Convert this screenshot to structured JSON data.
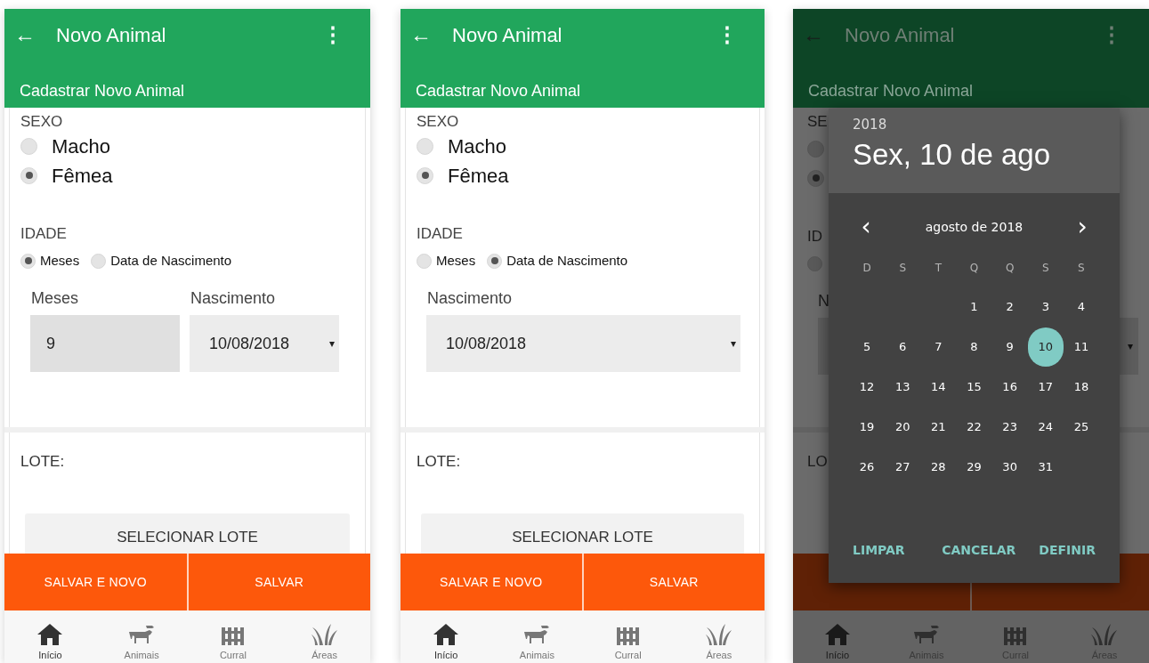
{
  "screens": [
    {
      "kind": "form",
      "header": {
        "back": "←",
        "title": "Novo Animal",
        "menu": "⋮",
        "subtitle": "Cadastrar Novo Animal"
      },
      "sexo": {
        "label": "SEXO",
        "options": [
          {
            "label": "Macho",
            "selected": false
          },
          {
            "label": "Fêmea",
            "selected": true
          }
        ]
      },
      "idade": {
        "label": "IDADE",
        "options": [
          {
            "label": "Meses",
            "selected": true
          },
          {
            "label": "Data de Nascimento",
            "selected": false
          }
        ]
      },
      "fields": [
        {
          "kind": "text",
          "label": "Meses",
          "value": "9"
        },
        {
          "kind": "select",
          "label": "Nascimento",
          "value": "10/08/2018",
          "arrow": "▾"
        }
      ],
      "lote": {
        "label": "LOTE:",
        "button": "SELECIONAR LOTE"
      },
      "actions": [
        "SALVAR E NOVO",
        "SALVAR"
      ],
      "nav": [
        {
          "label": "Início",
          "kind": "house",
          "selected": true
        },
        {
          "label": "Animais",
          "kind": "cattle",
          "selected": false
        },
        {
          "label": "Curral",
          "kind": "fence",
          "selected": false
        },
        {
          "label": "Áreas",
          "kind": "grass",
          "selected": false
        }
      ]
    },
    {
      "kind": "form",
      "header": {
        "back": "←",
        "title": "Novo Animal",
        "menu": "⋮",
        "subtitle": "Cadastrar Novo Animal"
      },
      "sexo": {
        "label": "SEXO",
        "options": [
          {
            "label": "Macho",
            "selected": false
          },
          {
            "label": "Fêmea",
            "selected": true
          }
        ]
      },
      "idade": {
        "label": "IDADE",
        "options": [
          {
            "label": "Meses",
            "selected": false
          },
          {
            "label": "Data de Nascimento",
            "selected": true
          }
        ]
      },
      "fields": [
        {
          "kind": "select",
          "label": "Nascimento",
          "value": "10/08/2018",
          "arrow": "▾"
        }
      ],
      "lote": {
        "label": "LOTE:",
        "button": "SELECIONAR LOTE"
      },
      "actions": [
        "SALVAR E NOVO",
        "SALVAR"
      ],
      "nav": [
        {
          "label": "Início",
          "kind": "house",
          "selected": true
        },
        {
          "label": "Animais",
          "kind": "cattle",
          "selected": false
        },
        {
          "label": "Curral",
          "kind": "fence",
          "selected": false
        },
        {
          "label": "Áreas",
          "kind": "grass",
          "selected": false
        }
      ]
    },
    {
      "kind": "picker",
      "header": {
        "back": "←",
        "title": "Novo Animal",
        "menu": "⋮",
        "subtitle": "Cadastrar Novo Animal"
      },
      "fragments": {
        "sexo": "SE",
        "sexo_radios": [
          {
            "selected": false
          },
          {
            "selected": true
          }
        ],
        "idade": "ID",
        "idade_radios": [
          {
            "selected": false
          }
        ],
        "field": "N",
        "arrow": "▾",
        "lote": "LO"
      },
      "nav": [
        {
          "label": "Início",
          "kind": "house",
          "selected": true
        },
        {
          "label": "Animais",
          "kind": "cattle",
          "selected": false
        },
        {
          "label": "Curral",
          "kind": "fence",
          "selected": false
        },
        {
          "label": "Áreas",
          "kind": "grass",
          "selected": false
        }
      ],
      "dialog": {
        "year": "2018",
        "date": "Sex, 10 de ago",
        "prev": "‹",
        "month": "agosto de 2018",
        "next": "›",
        "weekdays": [
          "D",
          "S",
          "T",
          "Q",
          "Q",
          "S",
          "S"
        ],
        "weeks": [
          [
            {
              "day": "1",
              "selected": false
            },
            {
              "day": "2",
              "selected": false
            },
            {
              "day": "3",
              "selected": false
            },
            {
              "day": "4",
              "selected": false
            }
          ],
          [
            {
              "day": "5",
              "selected": false
            },
            {
              "day": "6",
              "selected": false
            },
            {
              "day": "7",
              "selected": false
            },
            {
              "day": "8",
              "selected": false
            },
            {
              "day": "9",
              "selected": false
            },
            {
              "day": "10",
              "selected": true
            },
            {
              "day": "11",
              "selected": false
            }
          ],
          [
            {
              "day": "12",
              "selected": false
            },
            {
              "day": "13",
              "selected": false
            },
            {
              "day": "14",
              "selected": false
            },
            {
              "day": "15",
              "selected": false
            },
            {
              "day": "16",
              "selected": false
            },
            {
              "day": "17",
              "selected": false
            },
            {
              "day": "18",
              "selected": false
            }
          ],
          [
            {
              "day": "19",
              "selected": false
            },
            {
              "day": "20",
              "selected": false
            },
            {
              "day": "21",
              "selected": false
            },
            {
              "day": "22",
              "selected": false
            },
            {
              "day": "23",
              "selected": false
            },
            {
              "day": "24",
              "selected": false
            },
            {
              "day": "25",
              "selected": false
            }
          ],
          [
            {
              "day": "26",
              "selected": false
            },
            {
              "day": "27",
              "selected": false
            },
            {
              "day": "28",
              "selected": false
            },
            {
              "day": "29",
              "selected": false
            },
            {
              "day": "30",
              "selected": false
            },
            {
              "day": "31",
              "selected": false
            }
          ]
        ],
        "buttons": [
          "LIMPAR",
          "CANCELAR",
          "DEFINIR"
        ]
      }
    }
  ]
}
